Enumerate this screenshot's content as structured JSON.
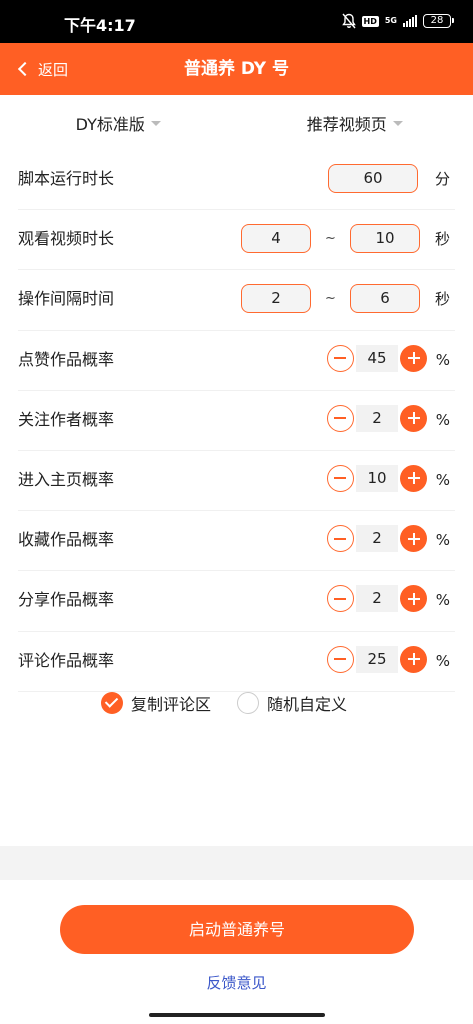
{
  "status_bar": {
    "time": "下午4:17",
    "hd_label": "HD",
    "network_label": "5G",
    "battery_level": "28"
  },
  "header": {
    "back_label": "返回",
    "title": "普通养 DY 号"
  },
  "dropdowns": {
    "version": "DY标准版",
    "page": "推荐视频页"
  },
  "settings": {
    "script_runtime": {
      "label": "脚本运行时长",
      "value": "60",
      "unit": "分"
    },
    "watch_duration": {
      "label": "观看视频时长",
      "min": "4",
      "separator": "~",
      "max": "10",
      "unit": "秒"
    },
    "operation_interval": {
      "label": "操作间隔时间",
      "min": "2",
      "separator": "~",
      "max": "6",
      "unit": "秒"
    }
  },
  "probabilities": [
    {
      "label": "点赞作品概率",
      "value": "45",
      "unit": "%"
    },
    {
      "label": "关注作者概率",
      "value": "2",
      "unit": "%"
    },
    {
      "label": "进入主页概率",
      "value": "10",
      "unit": "%"
    },
    {
      "label": "收藏作品概率",
      "value": "2",
      "unit": "%"
    },
    {
      "label": "分享作品概率",
      "value": "2",
      "unit": "%"
    },
    {
      "label": "评论作品概率",
      "value": "25",
      "unit": "%"
    }
  ],
  "comment_options": {
    "copy_comments": "复制评论区",
    "random_custom": "随机自定义",
    "selected": "copy_comments"
  },
  "actions": {
    "start_label": "启动普通养号",
    "feedback_label": "反馈意见"
  },
  "colors": {
    "accent": "#ff5f24",
    "link": "#3b57c9"
  }
}
